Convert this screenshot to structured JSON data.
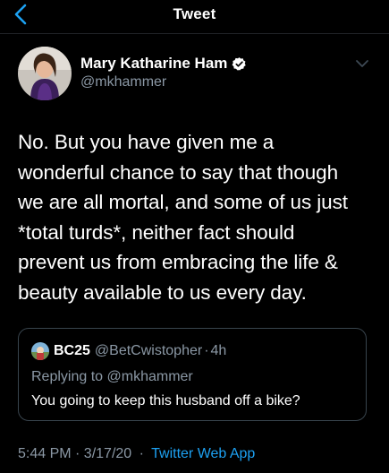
{
  "nav": {
    "title": "Tweet",
    "accent_color": "#1da1f2"
  },
  "author": {
    "name": "Mary Katharine Ham",
    "handle": "@mkhammer",
    "verified": true
  },
  "tweet": {
    "lines": [
      "No. But you have given me a",
      "wonderful chance to say that though",
      "we are all mortal, and some of us just",
      "*total turds*, neither fact should",
      "prevent us from embracing the life &",
      "beauty available to us every day."
    ]
  },
  "quote": {
    "name": "BC25",
    "handle": "@BetCwistopher",
    "separator": "·",
    "time": "4h",
    "replying_to": "Replying to @mkhammer",
    "text": "You going to keep this husband off a bike?"
  },
  "meta": {
    "timestamp": "5:44 PM · 3/17/20",
    "separator": "·",
    "source": "Twitter Web App"
  },
  "icons": {
    "back": "chevron-left-icon",
    "verified": "verified-badge-icon",
    "more": "chevron-down-icon"
  },
  "colors": {
    "background": "#000000",
    "text": "#ffffff",
    "secondary": "#8b98a5",
    "border": "#38444d",
    "link": "#1da1f2"
  }
}
